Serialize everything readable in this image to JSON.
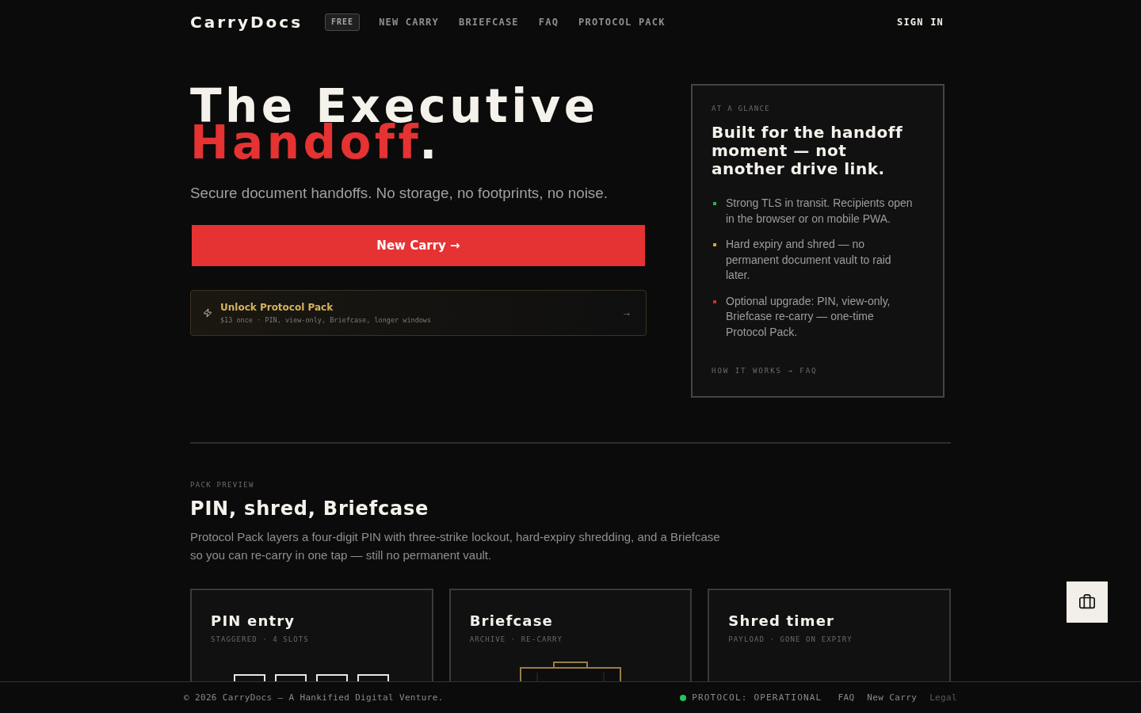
{
  "nav": {
    "logo": "CarryDocs",
    "badge": "FREE",
    "links": [
      {
        "label": "NEW CARRY"
      },
      {
        "label": "BRIEFCASE"
      },
      {
        "label": "FAQ"
      },
      {
        "label": "PROTOCOL PACK"
      }
    ],
    "sign_in": "SIGN IN"
  },
  "hero": {
    "title": [
      {
        "parts": [
          {
            "text": "The Executive",
            "accent": false
          }
        ]
      },
      {
        "parts": [
          {
            "text": "Handoff",
            "accent": true
          },
          {
            "text": ".",
            "accent": false
          }
        ]
      }
    ],
    "subtitle": "Secure document handoffs. No storage, no footprints, no noise.",
    "cta": "New Carry →",
    "upsell": {
      "title": "Unlock Protocol Pack",
      "detail": "$13 once · PIN, view-only, Briefcase, longer windows",
      "arrow": "→"
    }
  },
  "glance": {
    "eyebrow": "AT A GLANCE",
    "heading": "Built for the handoff moment — not another drive link.",
    "points": [
      {
        "text": "Strong TLS in transit. Recipients open in the browser or on mobile PWA.",
        "color": "#2fb14a"
      },
      {
        "text": "Hard expiry and shred — no permanent document vault to raid later.",
        "color": "#e2a229"
      },
      {
        "text": "Optional upgrade: PIN, view-only, Briefcase re-carry — one-time Protocol Pack.",
        "color": "#c9302c"
      }
    ],
    "link": "HOW IT WORKS → FAQ"
  },
  "preview": {
    "eyebrow": "PACK PREVIEW",
    "heading": "PIN, shred, Briefcase",
    "body": "Protocol Pack layers a four-digit PIN with three-strike lockout, hard-expiry shredding, and a Briefcase so you can re-carry in one tap — still no permanent vault.",
    "cards": [
      {
        "kind": "pin",
        "title": "PIN entry",
        "caption": "STAGGERED · 4 SLOTS"
      },
      {
        "kind": "briefcase",
        "title": "Briefcase",
        "caption": "ARCHIVE · RE-CARRY"
      },
      {
        "kind": "timer",
        "title": "Shred timer",
        "caption": "PAYLOAD · GONE ON EXPIRY"
      }
    ]
  },
  "footer": {
    "copyright": "© 2026 CarryDocs — A Hankified Digital Venture.",
    "status": "PROTOCOL: OPERATIONAL",
    "links": [
      {
        "label": "FAQ",
        "muted": false
      },
      {
        "label": "New Carry",
        "muted": false
      },
      {
        "label": "Legal",
        "muted": true
      }
    ]
  }
}
